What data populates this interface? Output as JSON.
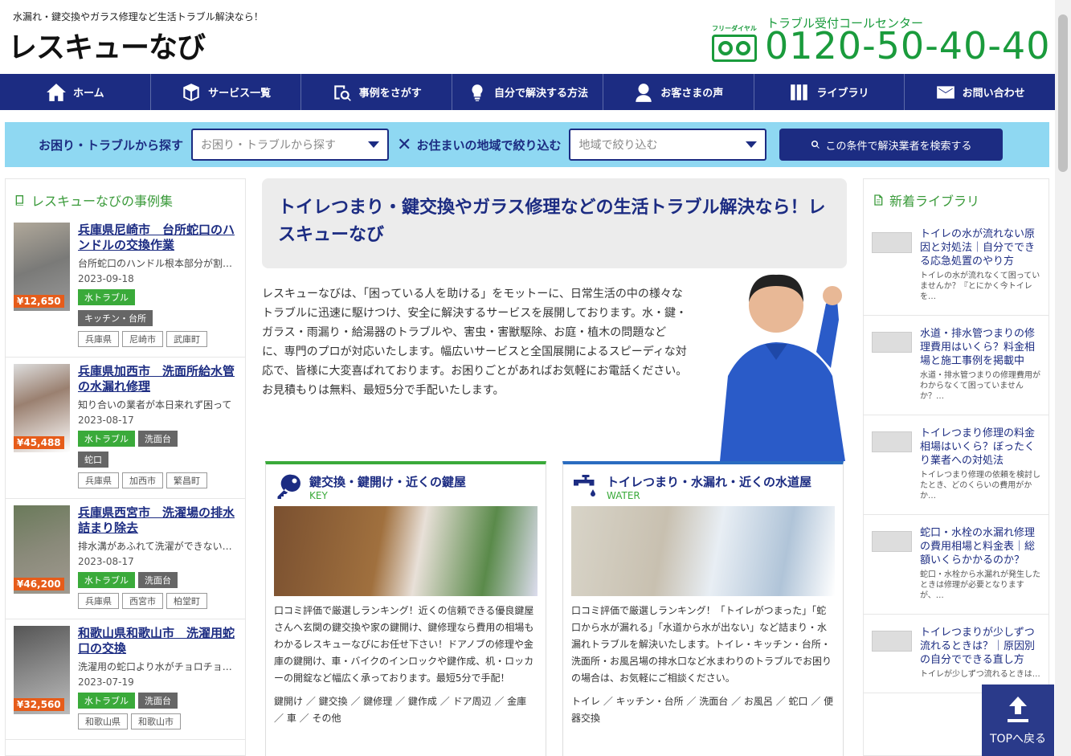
{
  "header": {
    "tagline": "水漏れ・鍵交換やガラス修理など生活トラブル解決なら！",
    "logo": "レスキューなび",
    "freedial_label": "フリーダイヤル",
    "callcenter": "トラブル受付コールセンター",
    "phone": "0120-50-40-40"
  },
  "nav": [
    {
      "label": "ホーム",
      "icon": "home-icon"
    },
    {
      "label": "サービス一覧",
      "icon": "box-icon"
    },
    {
      "label": "事例をさがす",
      "icon": "search-doc-icon"
    },
    {
      "label": "自分で解決する方法",
      "icon": "lightbulb-icon"
    },
    {
      "label": "お客さまの声",
      "icon": "user-icon"
    },
    {
      "label": "ライブラリ",
      "icon": "books-icon"
    },
    {
      "label": "お問い合わせ",
      "icon": "mail-icon"
    }
  ],
  "search": {
    "label_trouble": "お困り・トラブルから探す",
    "select_trouble": "お困り・トラブルから探す",
    "label_area": "お住まいの地域で絞り込む",
    "select_area": "地域で絞り込む",
    "button": "この条件で解決業者を検索する"
  },
  "cases": {
    "title": "レスキューなびの事例集",
    "items": [
      {
        "title": "兵庫県尼崎市　台所蛇口のハンドルの交換作業",
        "desc": "台所蛇口のハンドル根本部分が割れて",
        "date": "2023-09-18",
        "price": "¥12,650",
        "tags_green": [
          "水トラブル"
        ],
        "tags_gray": [
          "キッチン・台所"
        ],
        "areas": [
          "兵庫県",
          "尼崎市",
          "武庫町"
        ]
      },
      {
        "title": "兵庫県加西市　洗面所給水管の水漏れ修理",
        "desc": "知り合いの業者が本日来れず困って",
        "date": "2023-08-17",
        "price": "¥45,488",
        "tags_green": [
          "水トラブル"
        ],
        "tags_gray": [
          "洗面台",
          "蛇口"
        ],
        "areas": [
          "兵庫県",
          "加西市",
          "繁昌町"
        ]
      },
      {
        "title": "兵庫県西宮市　洗濯場の排水詰まり除去",
        "desc": "排水溝があふれて洗濯ができない状態",
        "date": "2023-08-17",
        "price": "¥46,200",
        "tags_green": [
          "水トラブル"
        ],
        "tags_gray": [
          "洗面台"
        ],
        "areas": [
          "兵庫県",
          "西宮市",
          "柏堂町"
        ]
      },
      {
        "title": "和歌山県和歌山市　洗濯用蛇口の交換",
        "desc": "洗濯用の蛇口より水がチョロチョロと",
        "date": "2023-07-19",
        "price": "¥32,560",
        "tags_green": [
          "水トラブル"
        ],
        "tags_gray": [
          "洗面台"
        ],
        "areas": [
          "和歌山県",
          "和歌山市"
        ]
      }
    ]
  },
  "library": {
    "title": "新着ライブラリ",
    "items": [
      {
        "title": "トイレの水が流れない原因と対処法｜自分でできる応急処置のやり方",
        "desc": "トイレの水が流れなくて困っていませんか？『とにかく今トイレを…"
      },
      {
        "title": "水道・排水管つまりの修理費用はいくら？料金相場と施工事例を掲載中",
        "desc": "水道・排水管つまりの修理費用がわからなくて困っていませんか？…"
      },
      {
        "title": "トイレつまり修理の料金相場はいくら？ぼったくり業者への対処法",
        "desc": "トイレつまり修理の依頼を検討したとき、どのくらいの費用がかか…"
      },
      {
        "title": "蛇口・水栓の水漏れ修理の費用相場と料金表｜総額いくらかかるのか？",
        "desc": "蛇口・水栓から水漏れが発生したときは修理が必要となりますが、…"
      },
      {
        "title": "トイレつまりが少しずつ流れるときは？｜原因別の自分でできる直し方",
        "desc": "トイレが少しずつ流れるときは…"
      }
    ]
  },
  "main": {
    "hero_title": "トイレつまり・鍵交換やガラス修理などの生活トラブル解決なら！レスキューなび",
    "intro": "レスキューなびは、「困っている人を助ける」をモットーに、日常生活の中の様々なトラブルに迅速に駆けつけ、安全に解決するサービスを展開しております。水・鍵・ガラス・雨漏り・給湯器のトラブルや、害虫・害獣駆除、お庭・植木の問題などに、専門のプロが対応いたします。幅広いサービスと全国展開によるスピーディな対応で、皆様に大変喜ばれております。お困りごとがあればお気軽にお電話ください。お見積もりは無料、最短5分で手配いたします。",
    "cards": [
      {
        "name": "鍵交換・鍵開け・近くの鍵屋",
        "en": "KEY",
        "text": "口コミ評価で厳選しランキング！近くの信頼できる優良鍵屋さんへ玄関の鍵交換や家の鍵開け、鍵修理なら費用の相場もわかるレスキューなびにお任せ下さい！ドアノブの修理や金庫の鍵開け、車・バイクのインロックや鍵作成、机・ロッカーの開錠など幅広く承っております。最短5分で手配！",
        "links": "鍵開け ／ 鍵交換 ／ 鍵修理 ／ 鍵作成 ／ ドア周辺 ／ 金庫 ／ 車 ／ その他"
      },
      {
        "name": "トイレつまり・水漏れ・近くの水道屋",
        "en": "WATER",
        "text": "口コミ評価で厳選しランキング！「トイレがつまった」「蛇口から水が漏れる」「水道から水が出ない」など詰まり・水漏れトラブルを解決いたします。トイレ・キッチン・台所・洗面所・お風呂場の排水口など水まわりのトラブルでお困りの場合は、お気軽にご相談ください。",
        "links": "トイレ ／ キッチン・台所 ／ 洗面台 ／ お風呂 ／ 蛇口 ／ 便器交換"
      }
    ]
  },
  "top_button": "TOPへ戻る"
}
